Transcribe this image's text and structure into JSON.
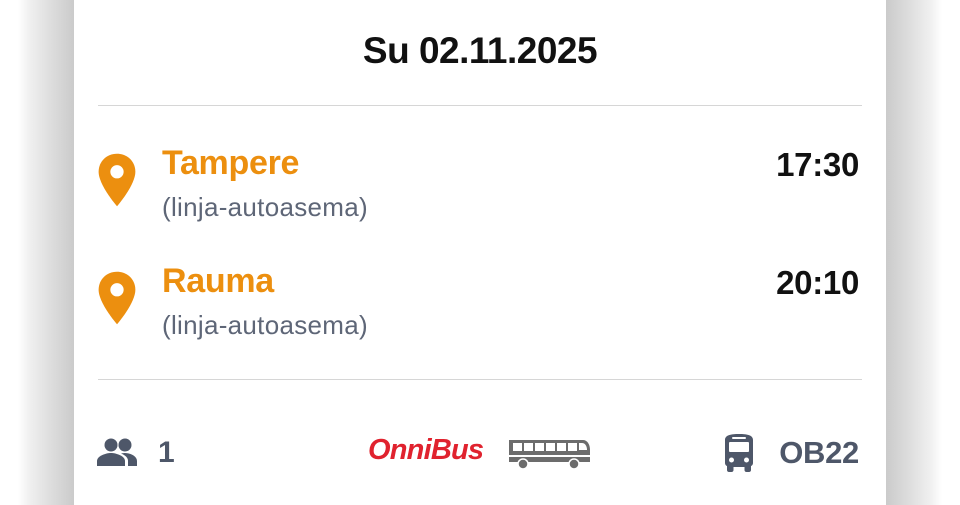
{
  "trip": {
    "date": "Su 02.11.2025",
    "departure": {
      "city": "Tampere",
      "station": "(linja-autoasema)",
      "time": "17:30"
    },
    "arrival": {
      "city": "Rauma",
      "station": "(linja-autoasema)",
      "time": "20:10"
    }
  },
  "footer": {
    "passenger_count": "1",
    "operator_logo_text": "OnniBus",
    "line_code": "OB22"
  },
  "colors": {
    "accent_orange": "#ec8f0f",
    "brand_red": "#e0222e",
    "muted_text": "#5e6677",
    "icon_gray": "#4e5769"
  },
  "icons": [
    "location-pin-icon",
    "passengers-icon",
    "bus-icon"
  ]
}
